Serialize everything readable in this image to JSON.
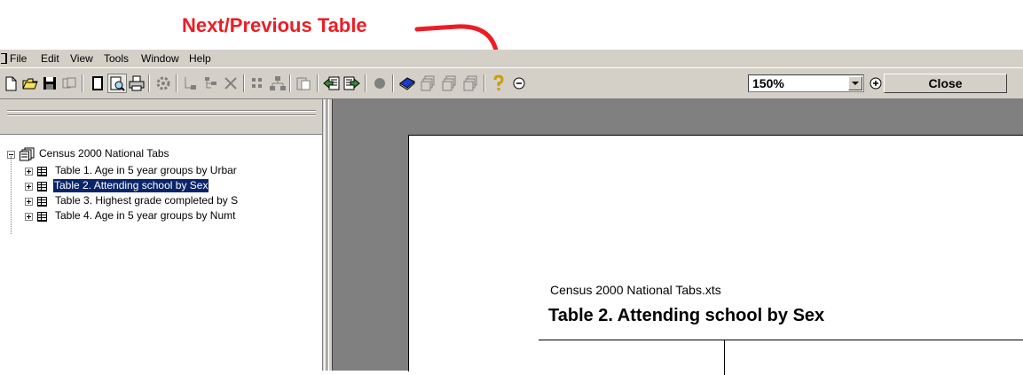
{
  "annotation": {
    "text": "Next/Previous Table",
    "color": "#ee1c24"
  },
  "menubar": {
    "items": [
      "File",
      "Edit",
      "View",
      "Tools",
      "Window",
      "Help"
    ]
  },
  "toolbar": {
    "buttons": [
      "new-document-icon",
      "open-folder-icon",
      "save-disk-icon",
      "copy-pages-icon",
      "single-page-icon",
      "print-preview-icon",
      "print-icon",
      "settings-gear-icon",
      "collapse-tree-icon",
      "expand-tree-icon",
      "delete-x-icon",
      "grid-icon",
      "hierarchy-icon",
      "paste-icon",
      "previous-table-icon",
      "next-table-icon",
      "stop-circle-icon",
      "book-icon",
      "stack-1-icon",
      "stack-2-icon",
      "stack-3-icon",
      "help-icon",
      "zoom-out-icon",
      "zoom-in-icon"
    ],
    "zoom": "150%",
    "close_label": "Close"
  },
  "tree": {
    "root": "Census 2000 National Tabs",
    "items": [
      {
        "label": "Table 1. Age in 5 year groups by Urbar",
        "selected": false
      },
      {
        "label": "Table 2. Attending school by Sex",
        "selected": true
      },
      {
        "label": "Table 3. Highest grade completed by S",
        "selected": false
      },
      {
        "label": "Table 4. Age in 5 year groups by Numt",
        "selected": false
      }
    ]
  },
  "document": {
    "filename": "Census 2000 National Tabs.xts",
    "title": "Table 2. Attending school by Sex"
  },
  "colors": {
    "chrome": "#d4d0c8",
    "selection": "#0a246a",
    "preview_background": "#808080"
  }
}
